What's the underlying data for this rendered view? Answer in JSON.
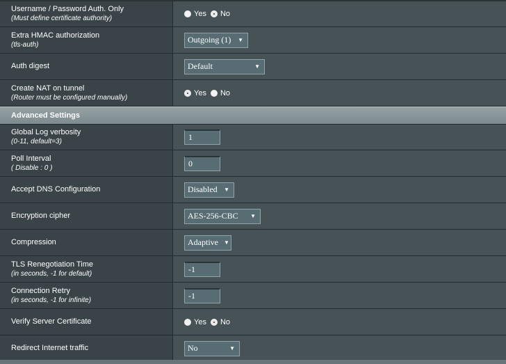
{
  "rows_top": [
    {
      "id": "userpass",
      "label": "Username / Password Auth. Only",
      "sub": "(Must define certificate authority)",
      "type": "radio",
      "options": [
        "Yes",
        "No"
      ],
      "selected": "No"
    },
    {
      "id": "hmac",
      "label": "Extra HMAC authorization",
      "sub": "(tls-auth)",
      "type": "select",
      "value": "Outgoing (1)"
    },
    {
      "id": "digest",
      "label": "Auth digest",
      "sub": "",
      "type": "select",
      "value": "Default"
    },
    {
      "id": "nat",
      "label": "Create NAT on tunnel",
      "sub": "(Router must be configured manually)",
      "type": "radio",
      "options": [
        "Yes",
        "No"
      ],
      "selected": "Yes"
    }
  ],
  "section": {
    "title": "Advanced Settings"
  },
  "rows_advanced": [
    {
      "id": "verb",
      "label": "Global Log verbosity",
      "sub": "(0-11, default=3)",
      "type": "input",
      "value": "1"
    },
    {
      "id": "poll",
      "label": "Poll Interval",
      "sub": "( Disable : 0 )",
      "type": "input",
      "value": "0"
    },
    {
      "id": "dns",
      "label": "Accept DNS Configuration",
      "sub": "",
      "type": "select",
      "value": "Disabled"
    },
    {
      "id": "cipher",
      "label": "Encryption cipher",
      "sub": "",
      "type": "select",
      "value": "AES-256-CBC"
    },
    {
      "id": "comp",
      "label": "Compression",
      "sub": "",
      "type": "select",
      "value": "Adaptive"
    },
    {
      "id": "reneg",
      "label": "TLS Renegotiation Time",
      "sub": "(in seconds, -1 for default)",
      "type": "input",
      "value": "-1"
    },
    {
      "id": "retry",
      "label": "Connection Retry",
      "sub": "(in seconds, -1 for infinite)",
      "type": "input",
      "value": "-1"
    },
    {
      "id": "verify",
      "label": "Verify Server Certificate",
      "sub": "",
      "type": "radio",
      "options": [
        "Yes",
        "No"
      ],
      "selected": "No"
    },
    {
      "id": "redirect",
      "label": "Redirect Internet traffic",
      "sub": "",
      "type": "select",
      "value": "No"
    }
  ]
}
